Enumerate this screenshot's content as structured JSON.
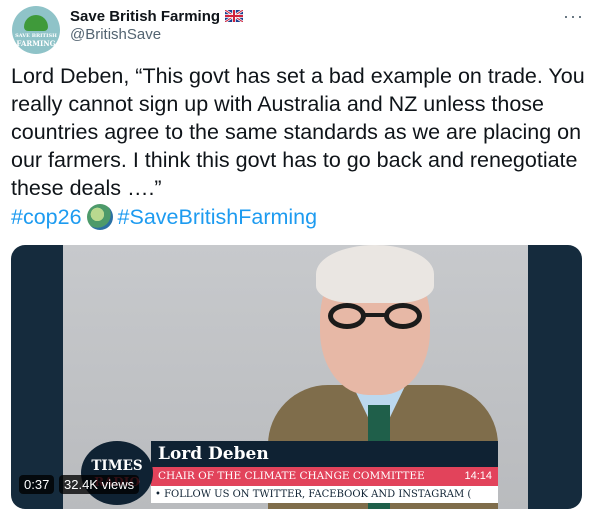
{
  "account": {
    "name": "Save British Farming",
    "handle": "@BritishSave",
    "avatar_line1": "SAVE BRITISH",
    "avatar_line2": "FARMING",
    "flag_icon": "uk-flag-icon"
  },
  "menu": {
    "more_label": "···"
  },
  "tweet": {
    "text": "Lord Deben, “This govt has set a bad example on trade. You really cannot sign up with Australia and NZ unless those countries agree to the same standards as we are placing on our farmers. I think this govt has to go back and renegotiate these deals ….”",
    "hashtags": [
      "#cop26",
      "#SaveBritishFarming"
    ],
    "emoji_icon": "earth-globe-icon"
  },
  "video": {
    "duration": "0:37",
    "views": "32.4K views",
    "lower_third_name": "Lord Deben",
    "lower_third_title": "CHAIR OF THE CLIMATE CHANGE COMMITTEE",
    "lower_third_time": "14:14",
    "ticker": "•    FOLLOW US ON TWITTER, FACEBOOK AND INSTAGRAM (",
    "logo_line1": "TIMES",
    "logo_line2": "RADIO"
  },
  "colors": {
    "link": "#1d9bf0",
    "accent_red": "#e2435b",
    "navy": "#0f2233"
  }
}
